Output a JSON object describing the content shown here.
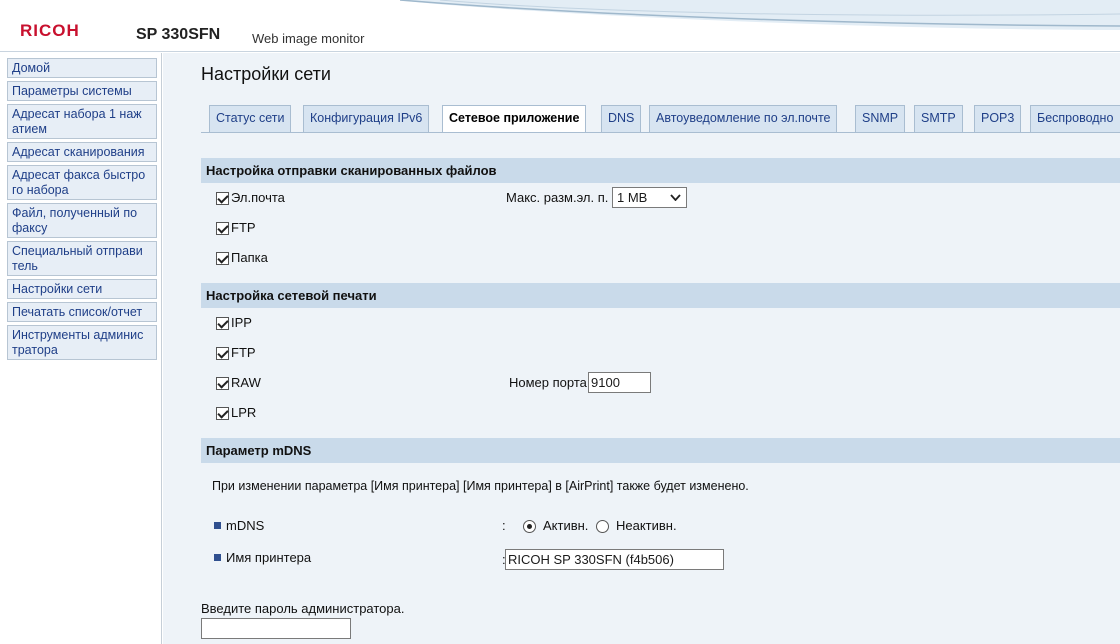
{
  "header": {
    "brand": "RICOH",
    "model": "SP 330SFN",
    "subtitle": "Web image monitor"
  },
  "sidebar": {
    "items": [
      {
        "line1": "Домой",
        "line2": ""
      },
      {
        "line1": "Параметры системы",
        "line2": ""
      },
      {
        "line1": "Адресат набора 1 наж",
        "line2": "атием"
      },
      {
        "line1": "Адресат сканирования",
        "line2": ""
      },
      {
        "line1": "Адресат факса быстро",
        "line2": "го набора"
      },
      {
        "line1": "Файл, полученный по",
        "line2": "факсу"
      },
      {
        "line1": "Специальный отправи",
        "line2": "тель"
      },
      {
        "line1": "Настройки сети",
        "line2": ""
      },
      {
        "line1": "Печатать список/отчет",
        "line2": ""
      },
      {
        "line1": "Инструменты админис",
        "line2": "тратора"
      }
    ]
  },
  "main": {
    "title": "Настройки сети",
    "tabs": [
      {
        "label": "Статус сети"
      },
      {
        "label": "Конфигурация IPv6"
      },
      {
        "label": "Сетевое приложение"
      },
      {
        "label": "DNS"
      },
      {
        "label": "Автоуведомление по эл.почте"
      },
      {
        "label": "SNMP"
      },
      {
        "label": "SMTP"
      },
      {
        "label": "POP3"
      },
      {
        "label": "Беспроводно"
      }
    ],
    "active_tab": "Сетевое приложение"
  },
  "scan": {
    "header": "Настройка отправки сканированных файлов",
    "email_label": "Эл.почта",
    "email_checked": true,
    "ftp_label": "FTP",
    "ftp_checked": true,
    "folder_label": "Папка",
    "folder_checked": true,
    "max_size_label": "Макс. разм.эл. п.",
    "max_size_value": "1 MB"
  },
  "print": {
    "header": "Настройка сетевой печати",
    "ipp_label": "IPP",
    "ipp_checked": true,
    "ftp_label": "FTP",
    "ftp_checked": true,
    "raw_label": "RAW",
    "raw_checked": true,
    "lpr_label": "LPR",
    "lpr_checked": true,
    "port_label": "Номер порта",
    "port_value": "9100"
  },
  "mdns": {
    "header": "Параметр mDNS",
    "note": "При изменении параметра [Имя принтера] [Имя принтера] в [AirPrint] также будет изменено.",
    "mdns_label": "mDNS",
    "colon": ":",
    "active_label": "Активн.",
    "inactive_label": "Неактивн.",
    "selected": "Активн.",
    "printer_name_label": "Имя принтера",
    "printer_name_value": "RICOH SP 330SFN (f4b506)"
  },
  "admin": {
    "password_label": "Введите пароль администратора.",
    "password_value": ""
  },
  "colors": {
    "brand": "#c8102e",
    "link": "#1f3f88",
    "section_bg": "#c9daea",
    "main_bg": "#eef3f8"
  }
}
